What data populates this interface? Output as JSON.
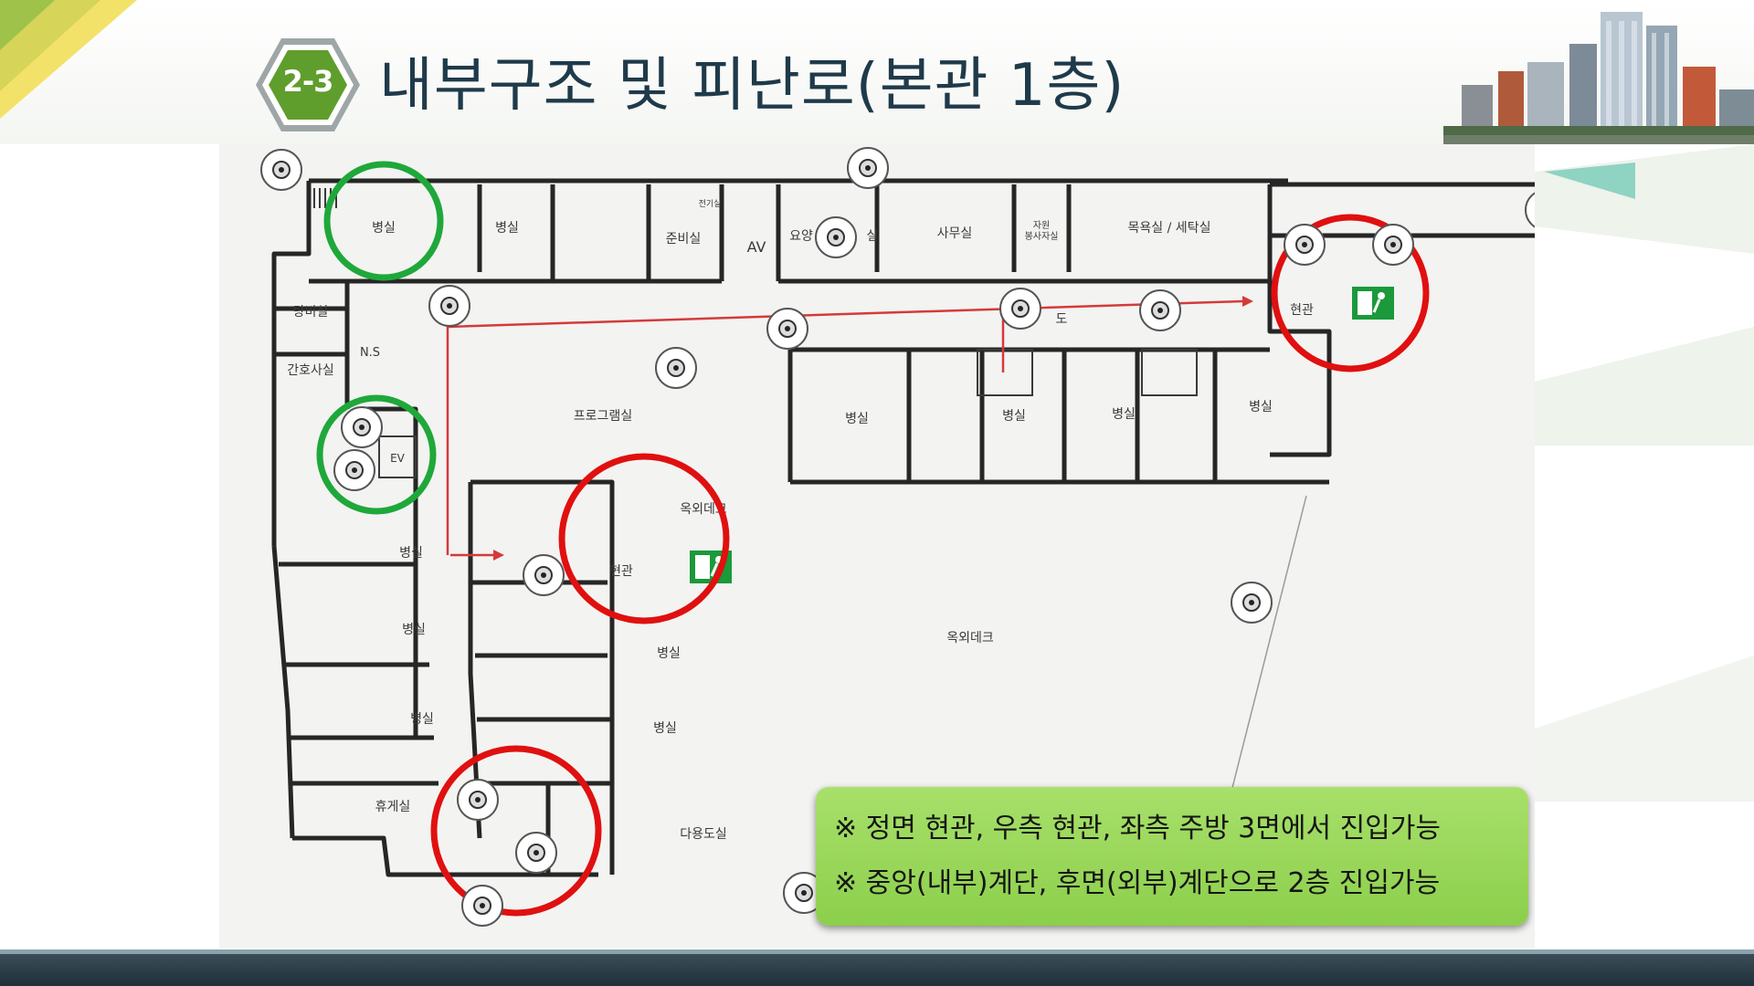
{
  "header": {
    "section_number": "2-3",
    "title": "내부구조 및 피난로(본관 1층)"
  },
  "floor_plan": {
    "rooms": {
      "ward_1": "병실",
      "ward_2": "병실",
      "prep_room": "준비실",
      "av_room": "AV",
      "yoyang_part": "요양",
      "sil_part": "실",
      "office": "사무실",
      "volunteer_room": "자원\n봉사자실",
      "bath_laundry": "목욕실 / 세탁실",
      "electric_room": "전기실",
      "tangbi_room": "탕비실",
      "nurse_station": "N.S",
      "nurse_office": "간호사실",
      "ev": "EV",
      "program_room": "프로그램실",
      "corridor": "도",
      "ward_e1": "병실",
      "ward_e2": "병실",
      "ward_e3": "병실",
      "ward_e4": "병실",
      "entrance_right": "현관",
      "outdoor_deck_small": "옥외데크",
      "entrance_front": "현관",
      "ward_w1": "병실",
      "ward_w2": "병실",
      "ward_w3": "병실",
      "ward_c1": "병실",
      "ward_c2": "병실",
      "lounge": "휴게실",
      "library": "다용도실",
      "outdoor_deck_large": "옥외데크"
    }
  },
  "notes": {
    "line1": "※ 정면 현관, 우측 현관, 좌측 주방 3면에서 진입가능",
    "line2": "※ 중앙(내부)계단, 후면(외부)계단으로 2층 진입가능"
  },
  "colors": {
    "title_text": "#1f3a4a",
    "badge": "#5f9e2c",
    "emergency_circle": "#e01010",
    "stair_circle": "#1fa83a",
    "evac_route": "#d43a3a",
    "note_bg": "#94d456",
    "exit_sign": "#1a9a3a"
  }
}
